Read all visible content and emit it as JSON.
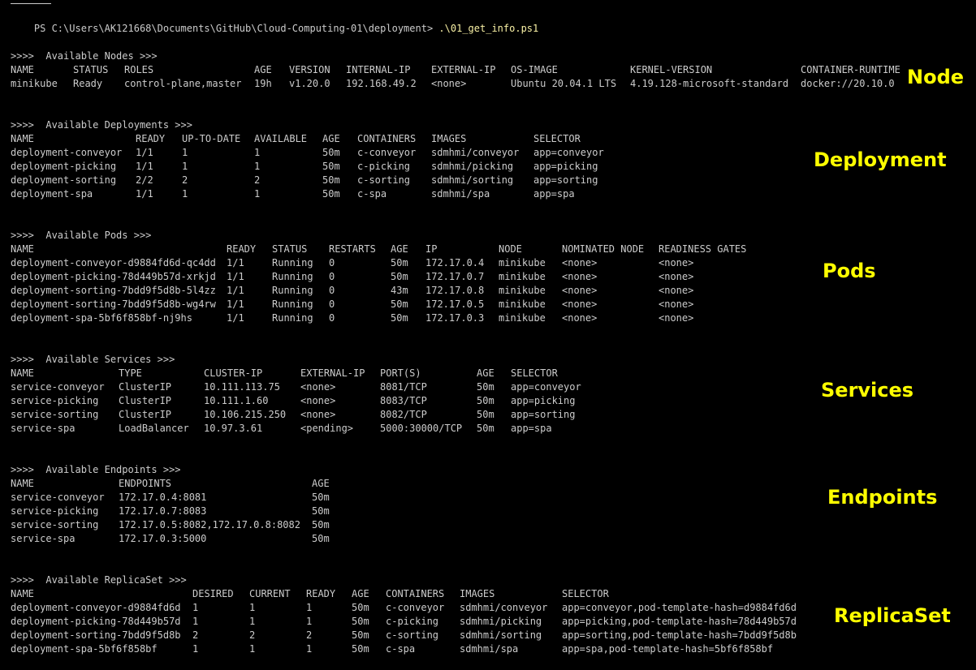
{
  "prompt": {
    "path": "PS C:\\Users\\AK121668\\Documents\\GitHub\\Cloud-Computing-01\\deployment>",
    "command": ".\\01_get_info.ps1"
  },
  "accent_color": "#ffff00",
  "sections": [
    {
      "id": "nodes",
      "heading": ">>>>  Available Nodes >>>",
      "label": "Node",
      "headers": [
        "NAME",
        "STATUS",
        "ROLES",
        "AGE",
        "VERSION",
        "INTERNAL-IP",
        "EXTERNAL-IP",
        "OS-IMAGE",
        "KERNEL-VERSION",
        "CONTAINER-RUNTIME"
      ],
      "rows": [
        [
          "minikube",
          "Ready",
          "control-plane,master",
          "19h",
          "v1.20.0",
          "192.168.49.2",
          "<none>",
          "Ubuntu 20.04.1 LTS",
          "4.19.128-microsoft-standard",
          "docker://20.10.0"
        ]
      ]
    },
    {
      "id": "deployments",
      "heading": ">>>>  Available Deployments >>>",
      "label": "Deployment",
      "headers": [
        "NAME",
        "READY",
        "UP-TO-DATE",
        "AVAILABLE",
        "AGE",
        "CONTAINERS",
        "IMAGES",
        "SELECTOR"
      ],
      "rows": [
        [
          "deployment-conveyor",
          "1/1",
          "1",
          "1",
          "50m",
          "c-conveyor",
          "sdmhmi/conveyor",
          "app=conveyor"
        ],
        [
          "deployment-picking",
          "1/1",
          "1",
          "1",
          "50m",
          "c-picking",
          "sdmhmi/picking",
          "app=picking"
        ],
        [
          "deployment-sorting",
          "2/2",
          "2",
          "2",
          "50m",
          "c-sorting",
          "sdmhmi/sorting",
          "app=sorting"
        ],
        [
          "deployment-spa",
          "1/1",
          "1",
          "1",
          "50m",
          "c-spa",
          "sdmhmi/spa",
          "app=spa"
        ]
      ]
    },
    {
      "id": "pods",
      "heading": ">>>>  Available Pods >>>",
      "label": "Pods",
      "headers": [
        "NAME",
        "READY",
        "STATUS",
        "RESTARTS",
        "AGE",
        "IP",
        "NODE",
        "NOMINATED NODE",
        "READINESS GATES"
      ],
      "rows": [
        [
          "deployment-conveyor-d9884fd6d-qc4dd",
          "1/1",
          "Running",
          "0",
          "50m",
          "172.17.0.4",
          "minikube",
          "<none>",
          "<none>"
        ],
        [
          "deployment-picking-78d449b57d-xrkjd",
          "1/1",
          "Running",
          "0",
          "50m",
          "172.17.0.7",
          "minikube",
          "<none>",
          "<none>"
        ],
        [
          "deployment-sorting-7bdd9f5d8b-5l4zz",
          "1/1",
          "Running",
          "0",
          "43m",
          "172.17.0.8",
          "minikube",
          "<none>",
          "<none>"
        ],
        [
          "deployment-sorting-7bdd9f5d8b-wg4rw",
          "1/1",
          "Running",
          "0",
          "50m",
          "172.17.0.5",
          "minikube",
          "<none>",
          "<none>"
        ],
        [
          "deployment-spa-5bf6f858bf-nj9hs",
          "1/1",
          "Running",
          "0",
          "50m",
          "172.17.0.3",
          "minikube",
          "<none>",
          "<none>"
        ]
      ]
    },
    {
      "id": "services",
      "heading": ">>>>  Available Services >>>",
      "label": "Services",
      "headers": [
        "NAME",
        "TYPE",
        "CLUSTER-IP",
        "EXTERNAL-IP",
        "PORT(S)",
        "AGE",
        "SELECTOR"
      ],
      "rows": [
        [
          "service-conveyor",
          "ClusterIP",
          "10.111.113.75",
          "<none>",
          "8081/TCP",
          "50m",
          "app=conveyor"
        ],
        [
          "service-picking",
          "ClusterIP",
          "10.111.1.60",
          "<none>",
          "8083/TCP",
          "50m",
          "app=picking"
        ],
        [
          "service-sorting",
          "ClusterIP",
          "10.106.215.250",
          "<none>",
          "8082/TCP",
          "50m",
          "app=sorting"
        ],
        [
          "service-spa",
          "LoadBalancer",
          "10.97.3.61",
          "<pending>",
          "5000:30000/TCP",
          "50m",
          "app=spa"
        ]
      ]
    },
    {
      "id": "endpoints",
      "heading": ">>>>  Available Endpoints >>>",
      "label": "Endpoints",
      "headers": [
        "NAME",
        "ENDPOINTS",
        "AGE"
      ],
      "rows": [
        [
          "service-conveyor",
          "172.17.0.4:8081",
          "50m"
        ],
        [
          "service-picking",
          "172.17.0.7:8083",
          "50m"
        ],
        [
          "service-sorting",
          "172.17.0.5:8082,172.17.0.8:8082",
          "50m"
        ],
        [
          "service-spa",
          "172.17.0.3:5000",
          "50m"
        ]
      ]
    },
    {
      "id": "replicasets",
      "heading": ">>>>  Available ReplicaSet >>>",
      "label": "ReplicaSet",
      "headers": [
        "NAME",
        "DESIRED",
        "CURRENT",
        "READY",
        "AGE",
        "CONTAINERS",
        "IMAGES",
        "SELECTOR"
      ],
      "rows": [
        [
          "deployment-conveyor-d9884fd6d",
          "1",
          "1",
          "1",
          "50m",
          "c-conveyor",
          "sdmhmi/conveyor",
          "app=conveyor,pod-template-hash=d9884fd6d"
        ],
        [
          "deployment-picking-78d449b57d",
          "1",
          "1",
          "1",
          "50m",
          "c-picking",
          "sdmhmi/picking",
          "app=picking,pod-template-hash=78d449b57d"
        ],
        [
          "deployment-sorting-7bdd9f5d8b",
          "2",
          "2",
          "2",
          "50m",
          "c-sorting",
          "sdmhmi/sorting",
          "app=sorting,pod-template-hash=7bdd9f5d8b"
        ],
        [
          "deployment-spa-5bf6f858bf",
          "1",
          "1",
          "1",
          "50m",
          "c-spa",
          "sdmhmi/spa",
          "app=spa,pod-template-hash=5bf6f858bf"
        ]
      ]
    }
  ]
}
